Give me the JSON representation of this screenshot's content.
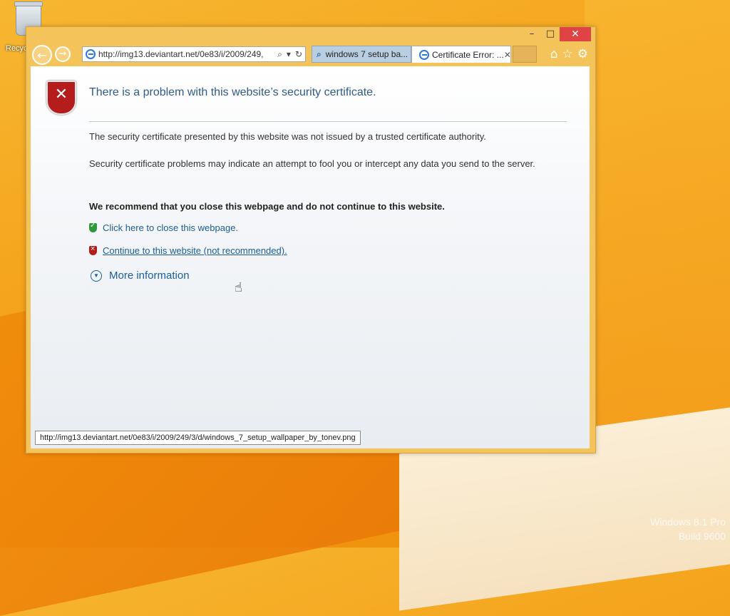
{
  "desktop": {
    "recycle_label": "Recyc",
    "watermark_line1": "Windows 8.1 Pro",
    "watermark_line2": "Build 9600"
  },
  "window": {
    "controls": {
      "minimize": "–",
      "maximize": "□",
      "close": "✕"
    }
  },
  "address_bar": {
    "url": "http://img13.deviantart.net/0e83/i/2009/249,"
  },
  "tabs": [
    {
      "label": "windows 7 setup ba...",
      "icon": "search-icon"
    },
    {
      "label": "Certificate Error: ...",
      "icon": "ie-icon",
      "close": "✕"
    }
  ],
  "page": {
    "heading": "There is a problem with this website’s security certificate.",
    "para1": "The security certificate presented by this website was not issued by a trusted certificate authority.",
    "para2": "Security certificate problems may indicate an attempt to fool you or intercept any data you send to the server.",
    "recommend": "We recommend that you close this webpage and do not continue to this website.",
    "close_link": "Click here to close this webpage.",
    "continue_link": "Continue to this website (not recommended).",
    "more_info": "More information"
  },
  "statusbar": {
    "text": "http://img13.deviantart.net/0e83/i/2009/249/3/d/windows_7_setup_wallpaper_by_tonev.png"
  }
}
